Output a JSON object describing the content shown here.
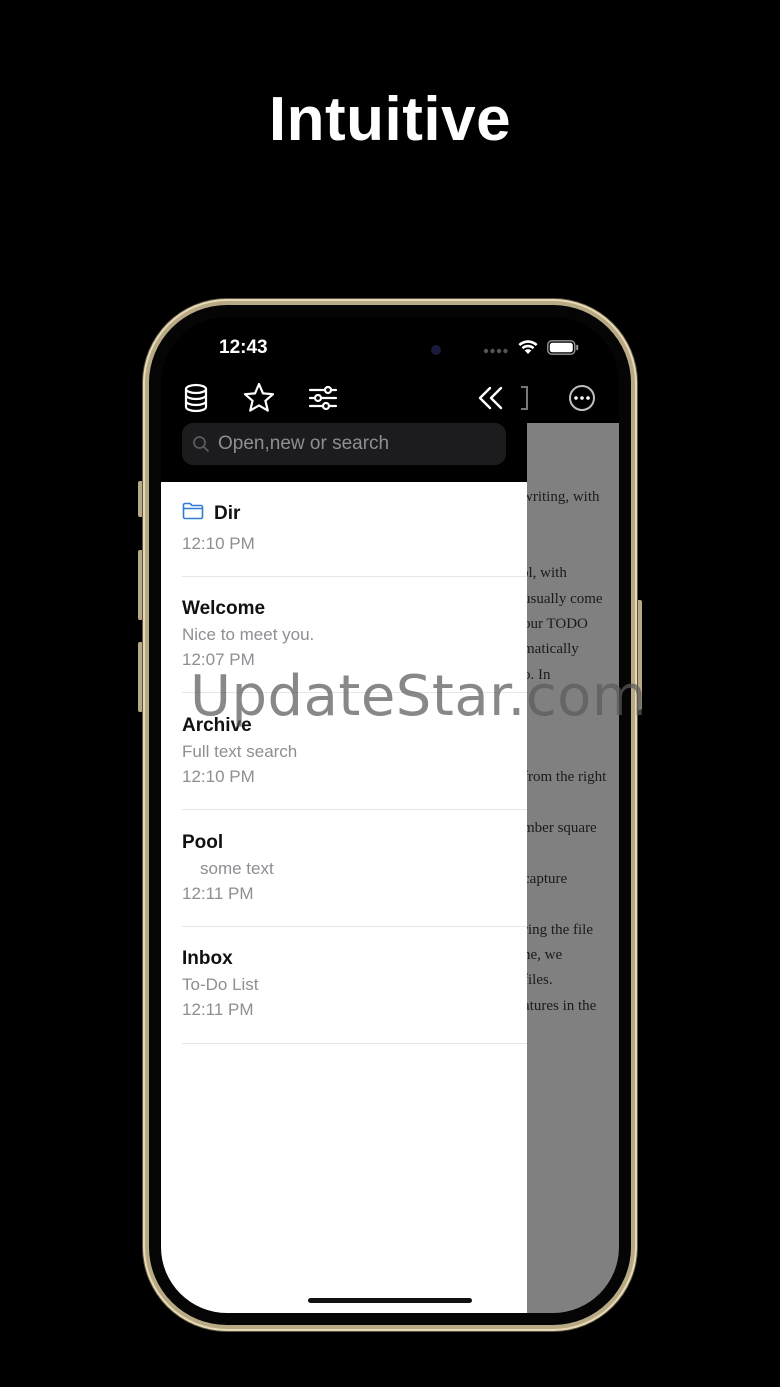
{
  "headline": "Intuitive",
  "status_bar": {
    "time": "12:43"
  },
  "search": {
    "placeholder": "Open,new or search"
  },
  "icons": {
    "database": "database-icon",
    "star": "star-icon",
    "filters": "sliders-icon",
    "collapse": "double-chevron-left-icon",
    "more": "ellipsis-circle-icon",
    "folder": "folder-icon"
  },
  "list": {
    "items": [
      {
        "title": "Dir",
        "subtitle": "",
        "time": "12:10 PM",
        "is_folder": true
      },
      {
        "title": "Welcome",
        "subtitle": "Nice to meet you.",
        "time": "12:07 PM"
      },
      {
        "title": "Archive",
        "subtitle": "Full text search",
        "time": "12:10 PM"
      },
      {
        "title": "Pool",
        "subtitle": "some text",
        "time": "12:11 PM"
      },
      {
        "title": "Inbox",
        "subtitle": "To-Do List",
        "time": "12:11 PM"
      }
    ]
  },
  "background_document": {
    "lines": [
      "writing, with",
      "ol, with",
      "usually come",
      "our TODO",
      "matically",
      "o. In",
      "from the right",
      "mber square",
      "capture",
      "ring the file",
      "ne, we",
      "files.",
      "atures in the"
    ]
  },
  "watermark": "UpdateStar.com",
  "colors": {
    "background": "#000000",
    "accent_folder": "#2f7bd6",
    "frame_gold": "#b9aa86",
    "secondary_text": "#8e8e93"
  }
}
